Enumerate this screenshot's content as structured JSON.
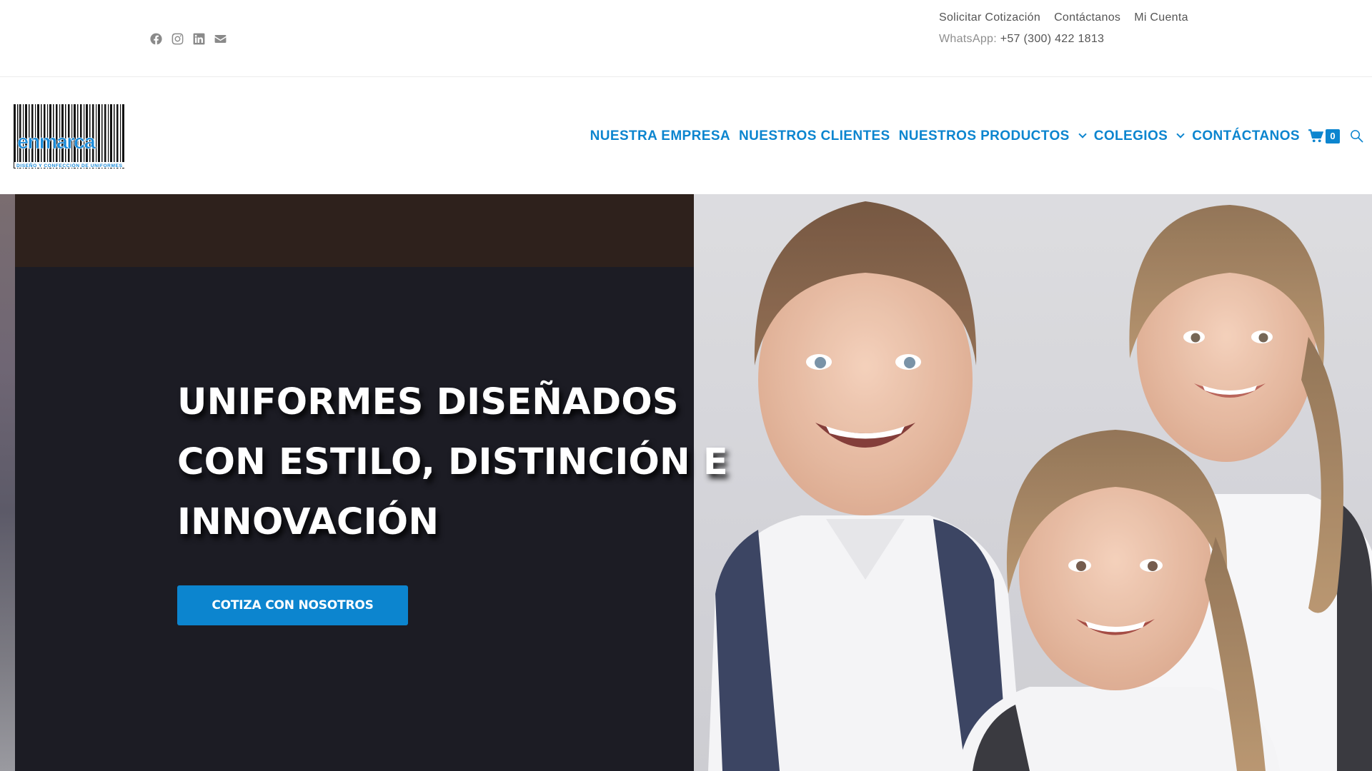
{
  "topbar": {
    "social_icons": [
      "facebook-icon",
      "instagram-icon",
      "linkedin-icon",
      "envelope-icon"
    ],
    "links": [
      "Solicitar Cotización",
      "Contáctanos",
      "Mi Cuenta"
    ],
    "whatsapp_label": "WhatsApp:",
    "whatsapp_number": "+57 (300) 422 1813"
  },
  "logo": {
    "brand": "enmarca",
    "tagline": "DISEÑO Y CONFECCIÓN DE UNIFORMES"
  },
  "nav": {
    "items": [
      {
        "label": "NUESTRA EMPRESA",
        "has_dropdown": false
      },
      {
        "label": "NUESTROS CLIENTES",
        "has_dropdown": false
      },
      {
        "label": "NUESTROS PRODUCTOS",
        "has_dropdown": true
      },
      {
        "label": "COLEGIOS",
        "has_dropdown": true
      },
      {
        "label": "CONTÁCTANOS",
        "has_dropdown": false
      }
    ],
    "cart_icon": "shopping-cart-icon",
    "cart_count": "0",
    "search_icon": "search-icon"
  },
  "hero": {
    "title": "UNIFORMES DISEÑADOS CON ESTILO, DISTINCIÓN E INNOVACIÓN",
    "cta_label": "COTIZA CON NOSOTROS"
  },
  "colors": {
    "accent": "#0c85cf",
    "hero_panel": "#1c1c24",
    "hero_panel_top": "#2e211c",
    "topbar_text": "#555555"
  }
}
